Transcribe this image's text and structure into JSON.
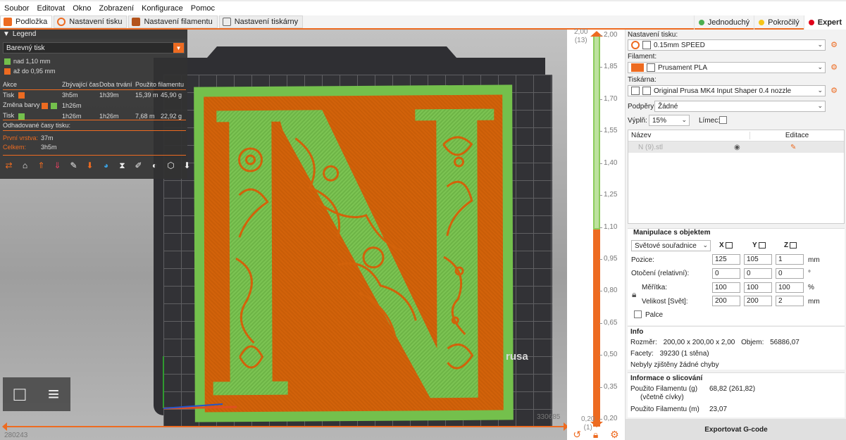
{
  "menu": [
    "Soubor",
    "Editovat",
    "Okno",
    "Zobrazení",
    "Konfigurace",
    "Pomoc"
  ],
  "tabs": [
    {
      "label": "Podložka",
      "icon": "plate-icon",
      "active": true
    },
    {
      "label": "Nastavení tisku",
      "icon": "gear-icon",
      "active": false
    },
    {
      "label": "Nastavení filamentu",
      "icon": "spool-icon",
      "active": false
    },
    {
      "label": "Nastavení tiskárny",
      "icon": "printer-icon",
      "active": false
    }
  ],
  "modes": [
    {
      "label": "Jednoduchý",
      "color": "#4caf50"
    },
    {
      "label": "Pokročilý",
      "color": "#f5c518"
    },
    {
      "label": "Expert",
      "color": "#e0001a"
    }
  ],
  "legend": {
    "title": "Legend",
    "view_type": "Barevný tisk",
    "ranges": [
      {
        "label": "nad 1,10 mm",
        "color": "#74c04c"
      },
      {
        "label": "až do 0,95 mm",
        "color": "#ed6b21"
      }
    ],
    "columns": [
      "Akce",
      "Zbývající čas",
      "Doba trvání",
      "Použito filamentu",
      ""
    ],
    "rows": [
      {
        "akce": "Tisk",
        "zbyva": "3h5m",
        "doba": "1h39m",
        "fil1": "15,39 m",
        "fil2": "45,90 g"
      },
      {
        "akce": "Změna barvy",
        "zbyva": "1h26m",
        "doba": "",
        "fil1": "",
        "fil2": ""
      },
      {
        "akce": "Tisk",
        "zbyva": "1h26m",
        "doba": "1h26m",
        "fil1": "7,68 m",
        "fil2": "22,92 g"
      }
    ],
    "estimated_title": "Odhadované časy tisku:",
    "first_layer_label": "První vrstva:",
    "first_layer_value": "37m",
    "total_label": "Celkem:",
    "total_value": "3h5m"
  },
  "scene": {
    "brand": "rusa",
    "coord_x": "330685",
    "coord_y": "280243"
  },
  "layer_slider": {
    "top_value": "2,00",
    "top_layer": "(13)",
    "bottom_value": "0,20",
    "bottom_layer": "(1)",
    "ticks": [
      "2,00",
      "1,85",
      "1,70",
      "1,55",
      "1,40",
      "1,25",
      "1,10",
      "0,95",
      "0,80",
      "0,65",
      "0,50",
      "0,35",
      "0,20"
    ],
    "change_at_fraction": 0.5
  },
  "sidebar": {
    "print_settings_label": "Nastavení tisku:",
    "print_settings_value": "0.15mm SPEED",
    "filament_label": "Filament:",
    "filament_value": "Prusament PLA",
    "filament_color": "#ed6b21",
    "printer_label": "Tiskárna:",
    "printer_value": "Original Prusa MK4 Input Shaper 0.4 nozzle",
    "supports_label": "Podpěry:",
    "supports_value": "Žádné",
    "infill_label": "Výplň:",
    "infill_value": "15%",
    "brim_label": "Límec:",
    "object_list": {
      "col_name": "Název",
      "col_edit": "Editace",
      "object_name": "N (9).stl"
    },
    "manipulation": {
      "title": "Manipulace s objektem",
      "coord_system": "Světové souřadnice",
      "axes": [
        "X",
        "Y",
        "Z"
      ],
      "position_label": "Pozice:",
      "position": [
        "125",
        "105",
        "1"
      ],
      "position_unit": "mm",
      "rotation_label": "Otočení (relativní):",
      "rotation": [
        "0",
        "0",
        "0"
      ],
      "rotation_unit": "°",
      "scale_label": "Měřítka:",
      "scale": [
        "100",
        "100",
        "100"
      ],
      "scale_unit": "%",
      "size_label": "Velikost [Svět]:",
      "size": [
        "200",
        "200",
        "2"
      ],
      "size_unit": "mm",
      "inches_label": "Palce"
    },
    "info": {
      "title": "Info",
      "size_label": "Rozměr:",
      "size_value": "200,00 x 200,00 x 2,00",
      "volume_label": "Objem:",
      "volume_value": "56886,07",
      "facets_label": "Facety:",
      "facets_value": "39230 (1 stěna)",
      "errors": "Nebyly zjištěny žádné chyby"
    },
    "slicing": {
      "title": "Informace o slicování",
      "filament_g_label": "Použito Filamentu (g)",
      "filament_g_sub": "(včetně cívky)",
      "filament_g_value": "68,82 (261,82)",
      "filament_m_label": "Použito Filamentu (m)",
      "filament_m_value": "23,07"
    },
    "export_label": "Exportovat G-code"
  }
}
